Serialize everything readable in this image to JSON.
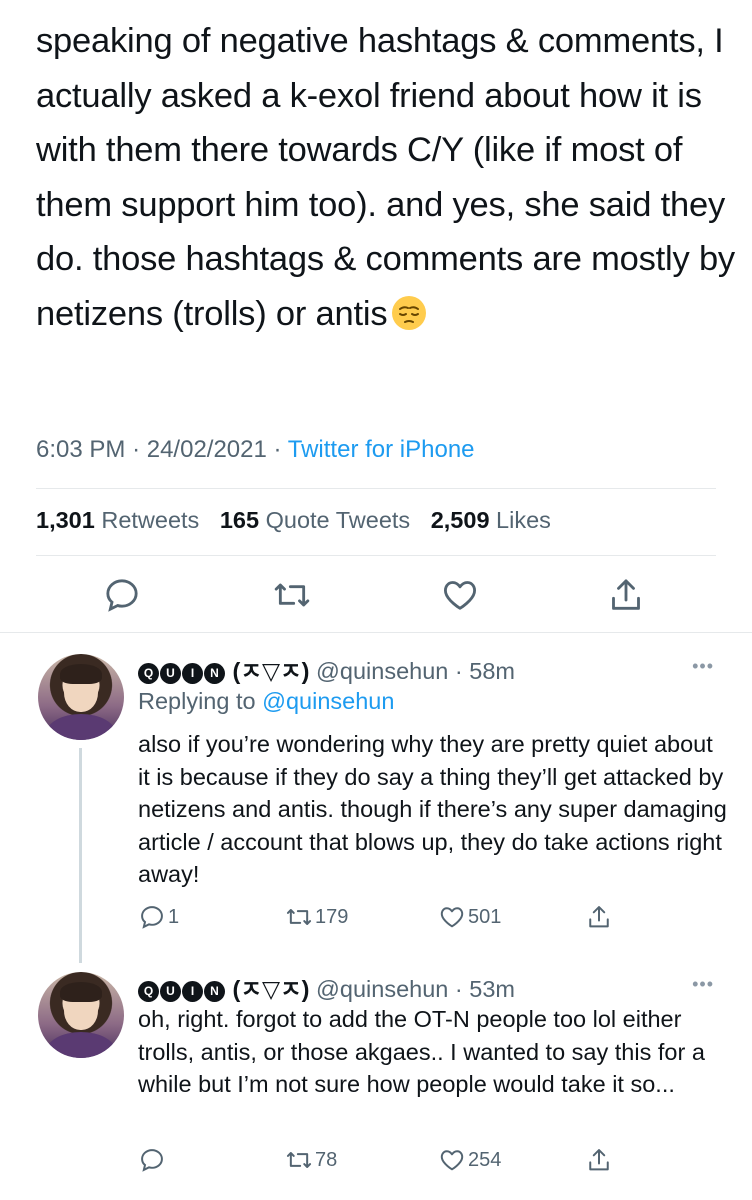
{
  "tweet": {
    "text": "speaking of negative hashtags & comments, I actually asked a k-exol friend about how it is with them there towards C/Y (like if most of them support him too). and yes, she said they do. those hashtags & comments are mostly by netizens (trolls) or antis",
    "emoji": "pensive-face",
    "time": "6:03 PM",
    "separator": "·",
    "date": "24/02/2021",
    "source": "Twitter for iPhone",
    "stats": {
      "retweets_count": "1,301",
      "retweets_label": "Retweets",
      "quotes_count": "165",
      "quotes_label": "Quote Tweets",
      "likes_count": "2,509",
      "likes_label": "Likes"
    }
  },
  "replies": [
    {
      "badges": [
        "Q",
        "U",
        "I",
        "N"
      ],
      "name_suffix": "(ㅈ▽ㅈ)",
      "handle": "@quinsehun",
      "time": "· 58m",
      "replying_label": "Replying to",
      "replying_to": "@quinsehun",
      "text": "also if you’re wondering why they are pretty quiet about it is because if they do say a thing they’ll get attacked by netizens and antis. though if there’s any super damaging article / account that blows up, they do take actions right away!",
      "reply_count": "1",
      "retweet_count": "179",
      "like_count": "501"
    },
    {
      "badges": [
        "Q",
        "U",
        "I",
        "N"
      ],
      "name_suffix": "(ㅈ▽ㅈ)",
      "handle": "@quinsehun",
      "time": "· 53m",
      "text": "oh, right. forgot to add the OT-N people too lol either trolls, antis, or those akgaes.. I wanted to say this for a while but I’m not sure how people would take it so...",
      "reply_count": "",
      "retweet_count": "78",
      "like_count": "254"
    }
  ],
  "more_glyph": "•••",
  "colors": {
    "accent": "#1d9bf0",
    "muted": "#536471",
    "text": "#0f1419"
  }
}
